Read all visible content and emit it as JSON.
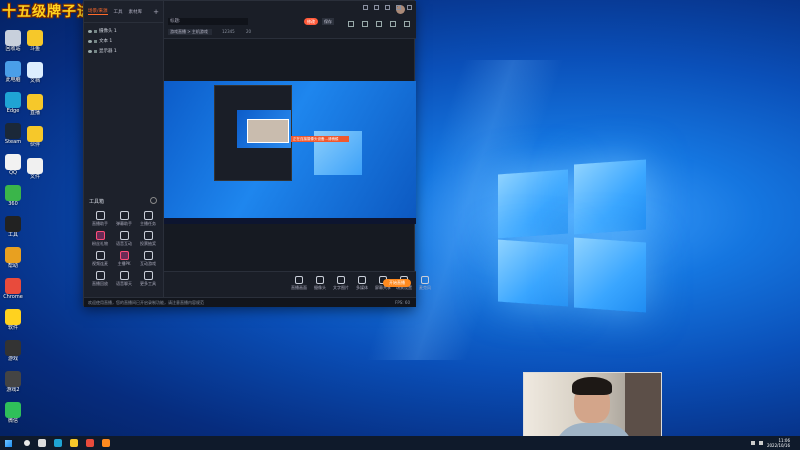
{
  "banner": "十五级牌子进粉丝群",
  "desktop": {
    "icons": [
      {
        "label": "回收站",
        "color": "#c8d0dc"
      },
      {
        "label": "此电脑",
        "color": "#4a9ee8"
      },
      {
        "label": "Edge",
        "color": "#1fa4d4"
      },
      {
        "label": "Steam",
        "color": "#1b2838"
      },
      {
        "label": "QQ",
        "color": "#f2f2f2"
      },
      {
        "label": "360",
        "color": "#3ab54a"
      },
      {
        "label": "工具",
        "color": "#222"
      },
      {
        "label": "帮助",
        "color": "#e8a020"
      },
      {
        "label": "Chrome",
        "color": "#e84b3c"
      },
      {
        "label": "软件",
        "color": "#ffd21f"
      },
      {
        "label": "游戏",
        "color": "#333"
      },
      {
        "label": "游戏2",
        "color": "#444"
      },
      {
        "label": "微信",
        "color": "#2fbf5a"
      }
    ],
    "icons_col2": [
      {
        "label": "斗鱼",
        "color": "#f6c82a"
      },
      {
        "label": "文档",
        "color": "#ddeeff"
      },
      {
        "label": "直播",
        "color": "#f6c82a"
      },
      {
        "label": "伙伴",
        "color": "#f6c82a"
      },
      {
        "label": "文件",
        "color": "#f0f0f0"
      }
    ]
  },
  "app": {
    "sidebar_tabs": [
      "场景/来源",
      "工具",
      "素材库"
    ],
    "scene_items": [
      "摄像头 1",
      "文本 1",
      "显示器 1"
    ],
    "tools_title": "工具箱",
    "tools": [
      "直播助手",
      "弹幕助手",
      "主播任务",
      "粉丝礼物",
      "语音互动",
      "投票抽奖",
      "视频连麦",
      "主播PK",
      "互动游戏",
      "直播回放",
      "语音聊天",
      "更多工具"
    ],
    "title_placeholder": "标题:",
    "btn_edit": "修改",
    "btn_save": "保存",
    "category": "游戏直播 > 主机游戏",
    "stats": {
      "viewers": "12345",
      "likes": "20"
    },
    "bottom_items": [
      "直播画面",
      "摄像头",
      "文字图片",
      "多媒体",
      "屏幕共享",
      "场景设置",
      "麦克风"
    ],
    "start_live": "开始直播",
    "cam_label": "正在连接摄像头设备...请稍候",
    "status_text": "欢迎使用直播，您的直播间已开启录制功能，请注意直播内容规范",
    "fps": "FPS: 60"
  },
  "taskbar": {
    "time": "11:06",
    "date": "2022/10/16"
  }
}
